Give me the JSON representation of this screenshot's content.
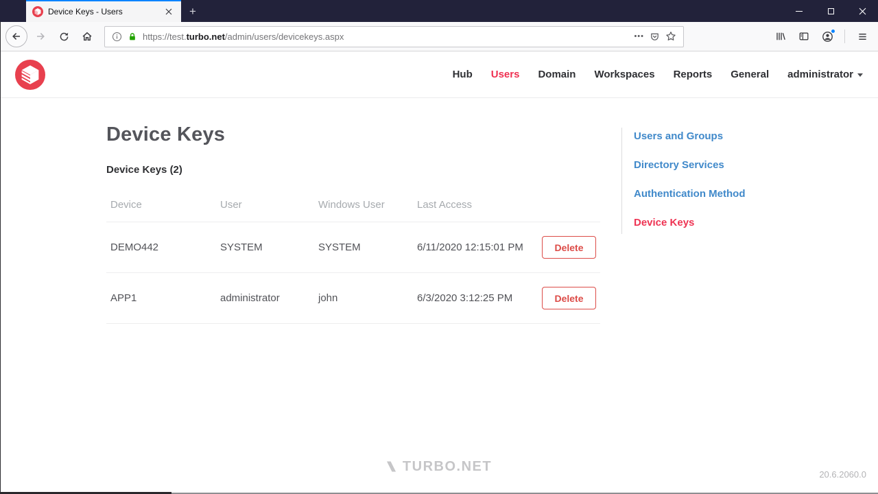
{
  "browser": {
    "tab_title": "Device Keys - Users",
    "new_tab_glyph": "+",
    "url_prefix": "https://test.",
    "url_domain": "turbo.net",
    "url_path": "/admin/users/devicekeys.aspx",
    "dots_glyph": "•••"
  },
  "nav": {
    "items": [
      {
        "label": "Hub"
      },
      {
        "label": "Users"
      },
      {
        "label": "Domain"
      },
      {
        "label": "Workspaces"
      },
      {
        "label": "Reports"
      },
      {
        "label": "General"
      },
      {
        "label": "administrator"
      }
    ]
  },
  "page": {
    "title": "Device Keys",
    "count_label": "Device Keys (2)"
  },
  "table": {
    "headers": [
      "Device",
      "User",
      "Windows User",
      "Last Access"
    ],
    "delete_label": "Delete",
    "rows": [
      {
        "device": "DEMO442",
        "user": "SYSTEM",
        "windows_user": "SYSTEM",
        "last_access": "6/11/2020 12:15:01 PM"
      },
      {
        "device": "APP1",
        "user": "administrator",
        "windows_user": "john",
        "last_access": "6/3/2020 3:12:25 PM"
      }
    ]
  },
  "sidebar": {
    "items": [
      {
        "label": "Users and Groups"
      },
      {
        "label": "Directory Services"
      },
      {
        "label": "Authentication Method"
      },
      {
        "label": "Device Keys"
      }
    ]
  },
  "footer": {
    "brand": "TURBO.NET",
    "version": "20.6.2060.0"
  },
  "colors": {
    "accent_red": "#ee3453",
    "delete_red": "#dc4b47",
    "link_blue": "#4089ca",
    "tab_accent_blue": "#0a84ff",
    "lock_green": "#23a303",
    "titlebar_bg": "#22223a",
    "logo_red": "#e8404e"
  }
}
